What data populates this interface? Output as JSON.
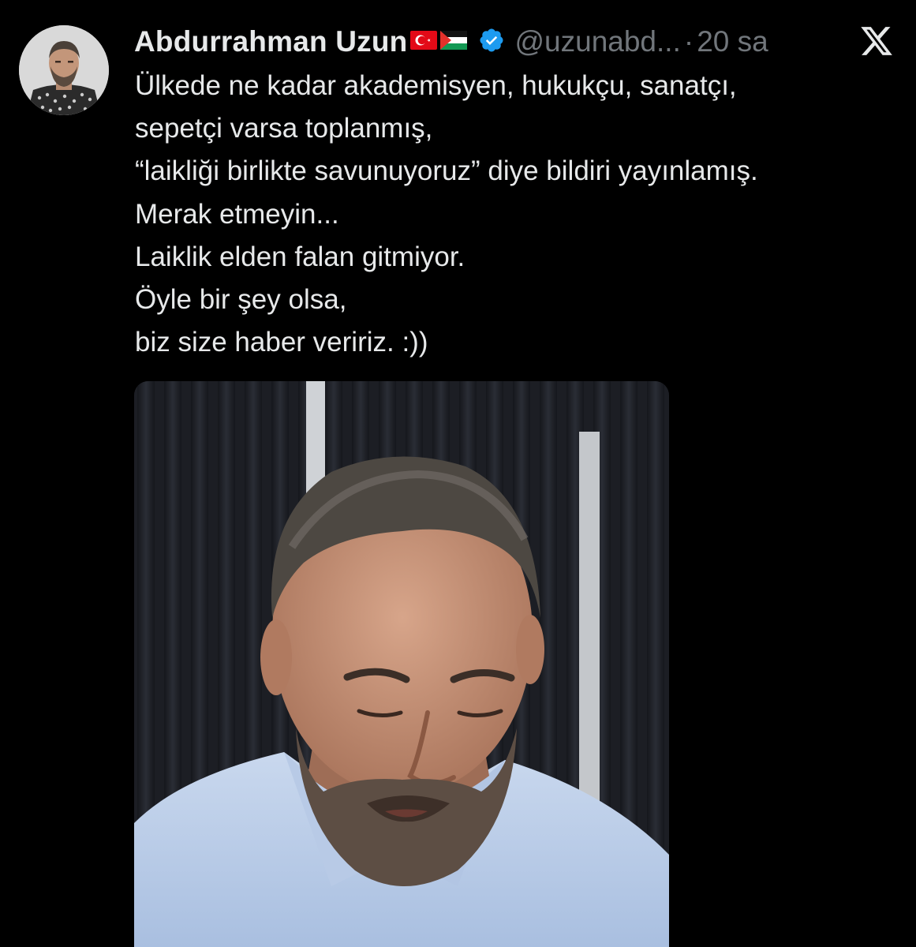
{
  "tweet": {
    "author_name": "Abdurrahman Uzun",
    "flags": [
      "turkey-flag-icon",
      "palestine-flag-icon"
    ],
    "verified_icon": "verified-badge-icon",
    "handle": "@uzunabd...",
    "separator": "·",
    "time": "20 sa",
    "platform_icon": "x-logo-icon",
    "text_lines": [
      "Ülkede ne kadar akademisyen, hukukçu, sanatçı,",
      "sepetçi varsa toplanmış,",
      "“laikliği birlikte savunuyoruz” diye bildiri yayınlamış.",
      "Merak etmeyin...",
      "Laiklik elden falan gitmiyor.",
      "Öyle bir şey olsa,",
      "biz size haber veririz. :))"
    ],
    "media_type": "video-frame"
  },
  "colors": {
    "background": "#000000",
    "primary_text": "#e7e9ea",
    "secondary_text": "#71767b",
    "verified_blue": "#1d9bf0"
  }
}
